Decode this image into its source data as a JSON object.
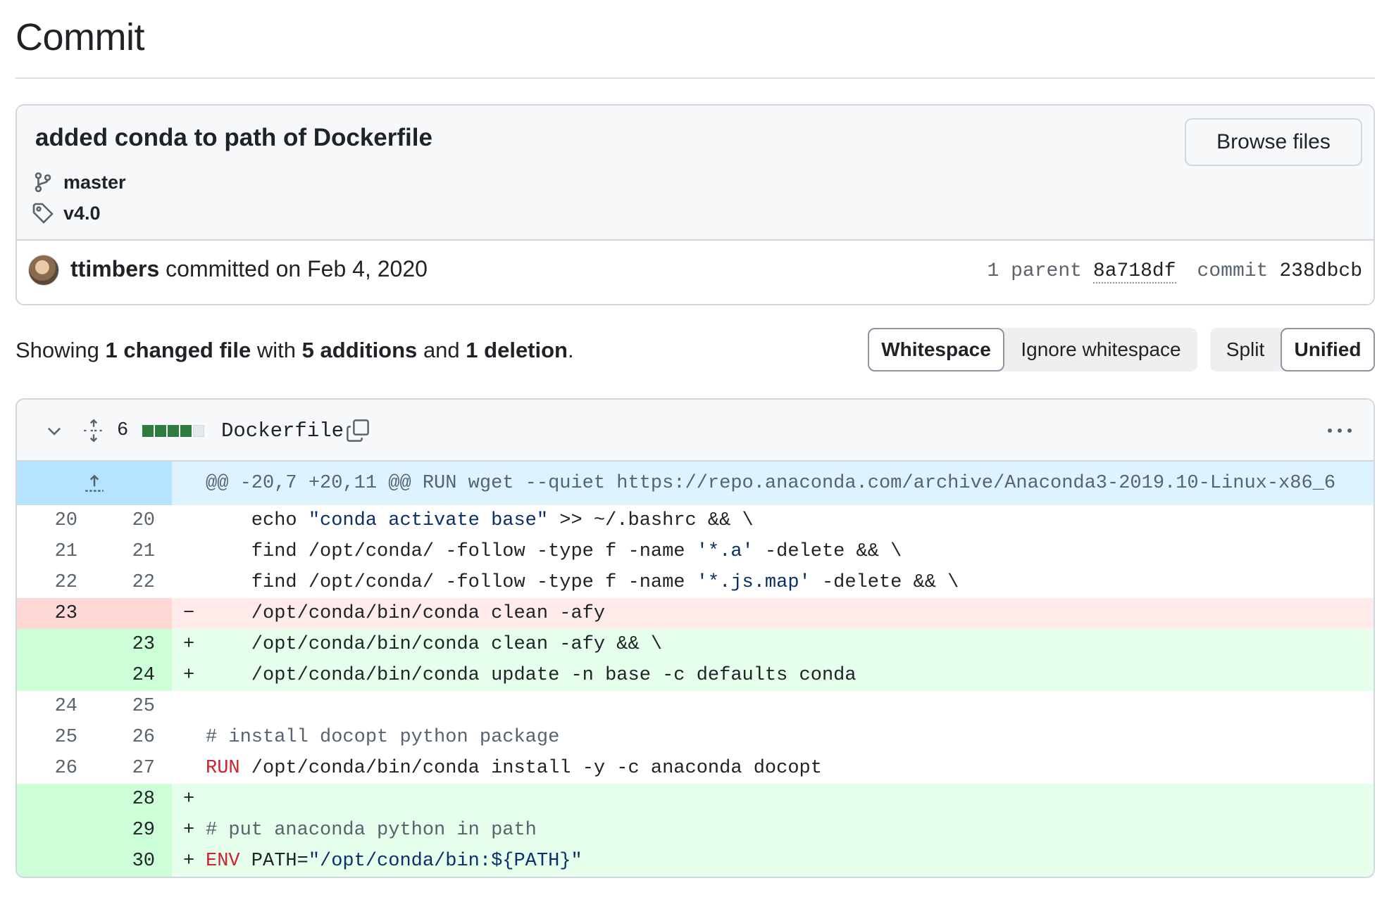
{
  "page": {
    "title": "Commit"
  },
  "commit": {
    "message": "added conda to path of Dockerfile",
    "browse_label": "Browse files",
    "branch": "master",
    "tag": "v4.0",
    "author": "ttimbers",
    "committed_text": "committed on Feb 4, 2020",
    "parent_label": "1 parent",
    "parent_sha": "8a718df",
    "commit_label": "commit",
    "commit_sha": "238dbcb"
  },
  "summary": {
    "showing": "Showing",
    "files": "1 changed file",
    "with": "with",
    "additions": "5 additions",
    "and": "and",
    "deletions": "1 deletion",
    "end": "."
  },
  "toolbar": {
    "whitespace": "Whitespace",
    "ignore_whitespace": "Ignore whitespace",
    "split": "Split",
    "unified": "Unified"
  },
  "file": {
    "change_count": "6",
    "name": "Dockerfile",
    "diffstat": [
      "add",
      "add",
      "add",
      "add",
      "neutral"
    ]
  },
  "diff": {
    "hunk_header": "@@ -20,7 +20,11 @@ RUN wget --quiet https://repo.anaconda.com/archive/Anaconda3-2019.10-Linux-x86_6",
    "lines": [
      {
        "type": "ctx",
        "old": "20",
        "new": "20",
        "sign": "",
        "segments": [
          [
            "    echo ",
            ""
          ],
          [
            "\"conda activate base\"",
            "str"
          ],
          [
            " >> ~/.bashrc && \\",
            ""
          ]
        ]
      },
      {
        "type": "ctx",
        "old": "21",
        "new": "21",
        "sign": "",
        "segments": [
          [
            "    find /opt/conda/ -follow -type f -name ",
            ""
          ],
          [
            "'*.a'",
            "str"
          ],
          [
            " -delete && \\",
            ""
          ]
        ]
      },
      {
        "type": "ctx",
        "old": "22",
        "new": "22",
        "sign": "",
        "segments": [
          [
            "    find /opt/conda/ -follow -type f -name ",
            ""
          ],
          [
            "'*.js.map'",
            "str"
          ],
          [
            " -delete && \\",
            ""
          ]
        ]
      },
      {
        "type": "del",
        "old": "23",
        "new": "",
        "sign": "−",
        "segments": [
          [
            "    /opt/conda/bin/conda clean -afy",
            ""
          ]
        ]
      },
      {
        "type": "add",
        "old": "",
        "new": "23",
        "sign": "+",
        "segments": [
          [
            "    /opt/conda/bin/conda clean -afy && \\",
            ""
          ]
        ]
      },
      {
        "type": "add",
        "old": "",
        "new": "24",
        "sign": "+",
        "segments": [
          [
            "    /opt/conda/bin/conda update -n base -c defaults conda",
            ""
          ]
        ]
      },
      {
        "type": "ctx",
        "old": "24",
        "new": "25",
        "sign": "",
        "segments": []
      },
      {
        "type": "ctx",
        "old": "25",
        "new": "26",
        "sign": "",
        "segments": [
          [
            "# install docopt python package",
            "com"
          ]
        ]
      },
      {
        "type": "ctx",
        "old": "26",
        "new": "27",
        "sign": "",
        "segments": [
          [
            "RUN",
            "kw"
          ],
          [
            " /opt/conda/bin/conda install -y -c anaconda docopt",
            ""
          ]
        ]
      },
      {
        "type": "add",
        "old": "",
        "new": "28",
        "sign": "+",
        "segments": []
      },
      {
        "type": "add",
        "old": "",
        "new": "29",
        "sign": "+",
        "segments": [
          [
            "# put anaconda python in path",
            "com"
          ]
        ]
      },
      {
        "type": "add",
        "old": "",
        "new": "30",
        "sign": "+",
        "segments": [
          [
            "ENV",
            "kw"
          ],
          [
            " PATH=",
            ""
          ],
          [
            "\"/opt/conda/bin:${PATH}\"",
            "str"
          ]
        ]
      }
    ]
  },
  "colors": {
    "addition_bg": "#e6ffec",
    "addition_gutter": "#ccffd8",
    "deletion_bg": "#ffebe9",
    "deletion_gutter": "#ffd7d5",
    "hunk_bg": "#ddf4ff",
    "diffstat_green": "#2f7d3e"
  },
  "icons": {
    "branch": "git-branch-icon",
    "tag": "tag-icon",
    "chevron": "chevron-down-icon",
    "expand": "unfold-icon",
    "copy": "copy-icon",
    "kebab": "kebab-horizontal-icon",
    "hunk_expand": "expand-up-icon"
  }
}
